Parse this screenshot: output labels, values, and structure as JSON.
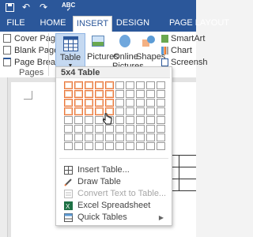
{
  "titlebar": {
    "quick_access": [
      "save-icon",
      "undo-icon",
      "redo-icon",
      "spelling-icon"
    ]
  },
  "tabs": [
    {
      "label": "FILE"
    },
    {
      "label": "HOME"
    },
    {
      "label": "INSERT"
    },
    {
      "label": "DESIGN"
    },
    {
      "label": "PAGE LAYOUT"
    }
  ],
  "ribbon": {
    "pages": {
      "items": [
        {
          "label": "Cover Page"
        },
        {
          "label": "Blank Page"
        },
        {
          "label": "Page Break"
        }
      ],
      "group_label": "Pages"
    },
    "table_button": {
      "label": "Table"
    },
    "pictures": {
      "label": "Pictures"
    },
    "online_pictures": {
      "label": "Online Pictures"
    },
    "shapes": {
      "label": "Shapes"
    },
    "right_items": [
      {
        "label": "SmartArt"
      },
      {
        "label": "Chart"
      },
      {
        "label": "Screensh"
      }
    ]
  },
  "table_menu": {
    "header": "5x4 Table",
    "grid": {
      "columns": 10,
      "rows": 8,
      "selected_columns": 5,
      "selected_rows": 4
    },
    "items": [
      {
        "label": "Insert Table...",
        "disabled": false
      },
      {
        "label": "Draw Table",
        "disabled": false
      },
      {
        "label": "Convert Text to Table...",
        "disabled": true
      },
      {
        "label": "Excel Spreadsheet",
        "disabled": false
      },
      {
        "label": "Quick Tables",
        "disabled": false
      }
    ]
  },
  "colors": {
    "ribbon_blue": "#2b579a",
    "selected_cell_border": "#e9773d",
    "active_button_bg": "#c5d9f1"
  }
}
